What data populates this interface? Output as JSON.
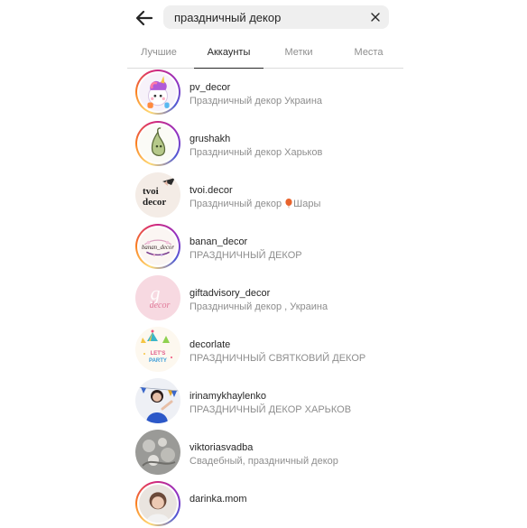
{
  "search": {
    "value": "праздничный декор"
  },
  "tabs": [
    {
      "label": "Лучшие",
      "active": false
    },
    {
      "label": "Аккаунты",
      "active": true
    },
    {
      "label": "Метки",
      "active": false
    },
    {
      "label": "Места",
      "active": false
    }
  ],
  "accounts": [
    {
      "username": "pv_decor",
      "subtitle": "Праздничный декор Украина",
      "story_ring": true
    },
    {
      "username": "grushakh",
      "subtitle": "Праздничный декор Харьков",
      "story_ring": true
    },
    {
      "username": "tvoi.decor",
      "subtitle_before": "Праздничный декор ",
      "subtitle_icon": "balloon-icon",
      "subtitle_after": "Шары",
      "story_ring": false
    },
    {
      "username": "banan_decor",
      "subtitle": "ПРАЗДНИЧНЫЙ ДЕКОР",
      "story_ring": true
    },
    {
      "username": "giftadvisory_decor",
      "subtitle": "Праздничный декор , Украина",
      "story_ring": false
    },
    {
      "username": "decorlate",
      "subtitle": "ПРАЗДНИЧНЫЙ СВЯТКОВИЙ ДЕКОР",
      "story_ring": false
    },
    {
      "username": "irinamykhaylenko",
      "subtitle": "ПРАЗДНИЧНЫЙ ДЕКОР ХАРЬКОВ",
      "story_ring": false
    },
    {
      "username": "viktoriasvadba",
      "subtitle": "Свадебный, праздничный декор",
      "story_ring": false
    },
    {
      "username": "darinka.mom",
      "subtitle": "",
      "story_ring": true
    }
  ],
  "avatar_texts": {
    "tvoi": "tvoi",
    "decor": "decor",
    "banan": "banan_decor",
    "gift_letter": "g",
    "gift_word": "decor",
    "lets": "LET'S",
    "party": "PARTY"
  },
  "colors": {
    "ring": "#d62976",
    "text_primary": "#262626",
    "text_secondary": "#8e8e8e",
    "search_bg": "#efefef"
  }
}
